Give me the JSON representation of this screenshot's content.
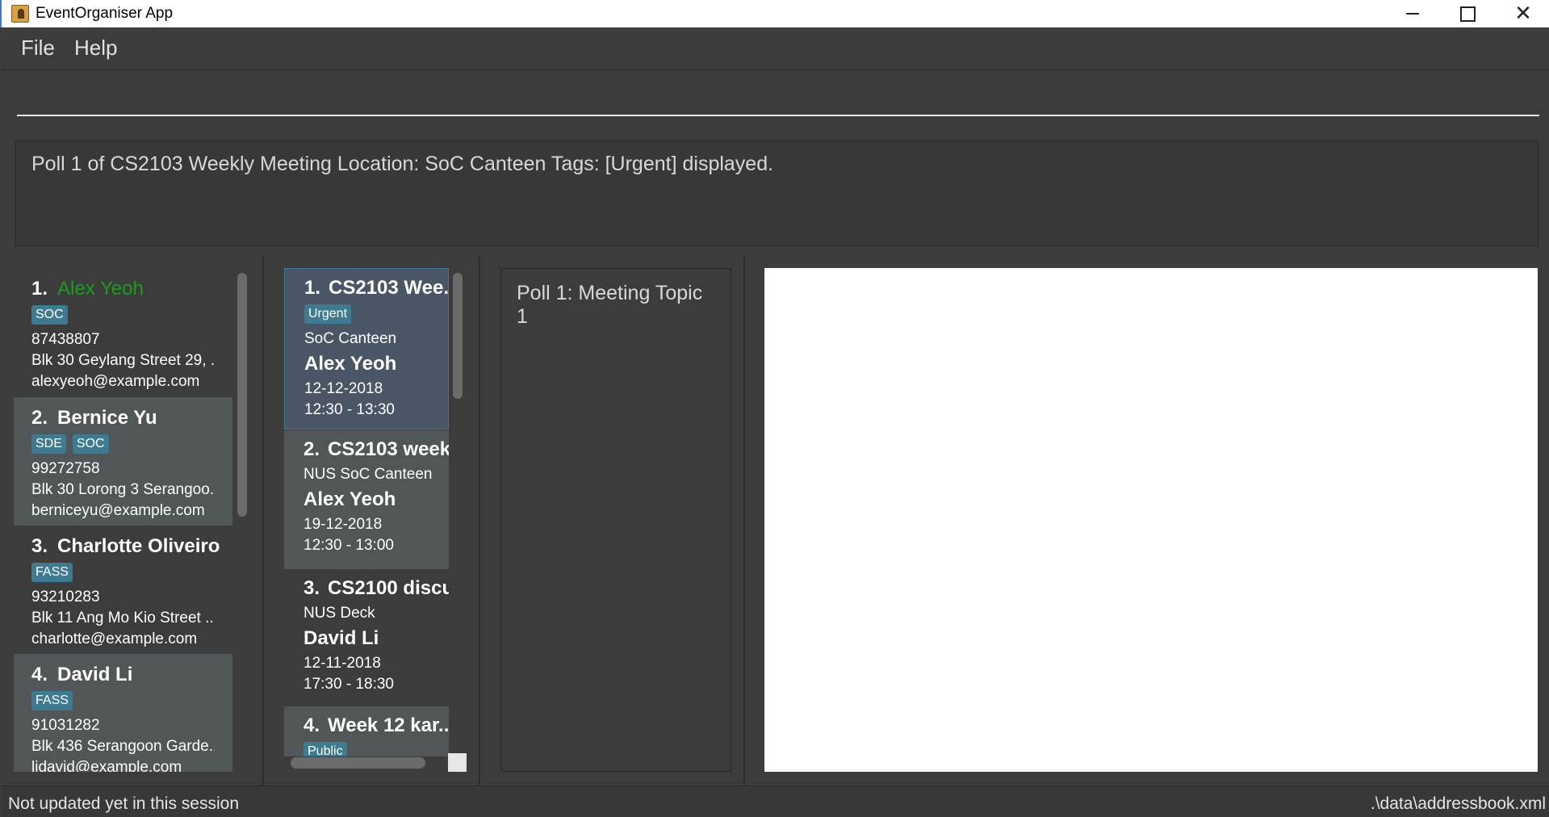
{
  "window": {
    "title": "EventOrganiser App",
    "icons": {
      "app": "app-icon",
      "minimize": "minimize-icon",
      "maximize": "maximize-icon",
      "close": "close-icon"
    }
  },
  "menu": {
    "file": "File",
    "help": "Help"
  },
  "command": {
    "value": "",
    "placeholder": ""
  },
  "result": {
    "text": "Poll 1 of CS2103 Weekly Meeting Location: SoC Canteen Tags: [Urgent] displayed."
  },
  "persons": [
    {
      "index": "1.",
      "name": "Alex Yeoh",
      "tags": [
        "SOC"
      ],
      "phone": "87438807",
      "address": "Blk 30 Geylang Street 29, ...",
      "email": "alexyeoh@example.com"
    },
    {
      "index": "2.",
      "name": "Bernice Yu",
      "tags": [
        "SDE",
        "SOC"
      ],
      "phone": "99272758",
      "address": "Blk 30 Lorong 3 Serangoo...",
      "email": "berniceyu@example.com"
    },
    {
      "index": "3.",
      "name": "Charlotte Oliveiro",
      "tags": [
        "FASS"
      ],
      "phone": "93210283",
      "address": "Blk 11 Ang Mo Kio Street ...",
      "email": "charlotte@example.com"
    },
    {
      "index": "4.",
      "name": "David Li",
      "tags": [
        "FASS"
      ],
      "phone": "91031282",
      "address": "Blk 436 Serangoon Garde...",
      "email": "lidavid@example.com"
    }
  ],
  "events": [
    {
      "index": "1.",
      "title": "CS2103 Wee...",
      "tags": [
        "Urgent"
      ],
      "location": "SoC Canteen",
      "organiser": "Alex Yeoh",
      "date": "12-12-2018",
      "time": "12:30 - 13:30"
    },
    {
      "index": "2.",
      "title": "CS2103 week...",
      "tags": [],
      "location": "NUS SoC Canteen",
      "organiser": "Alex Yeoh",
      "date": "19-12-2018",
      "time": "12:30 - 13:00"
    },
    {
      "index": "3.",
      "title": "CS2100 discu...",
      "tags": [],
      "location": "NUS Deck",
      "organiser": "David Li",
      "date": "12-11-2018",
      "time": "17:30 - 18:30"
    },
    {
      "index": "4.",
      "title": "Week 12 kar...",
      "tags": [
        "Public"
      ],
      "location": "",
      "organiser": "",
      "date": "",
      "time": ""
    }
  ],
  "poll": {
    "title": "Poll 1: Meeting Topic 1"
  },
  "status": {
    "left": "Not updated yet in this session",
    "right": ".\\data\\addressbook.xml"
  },
  "colors": {
    "accent": "#1f9a1f",
    "tag": "#3e7b91",
    "background": "#3c3c3c",
    "card_alt": "#515658",
    "selected": "#4a5666"
  }
}
